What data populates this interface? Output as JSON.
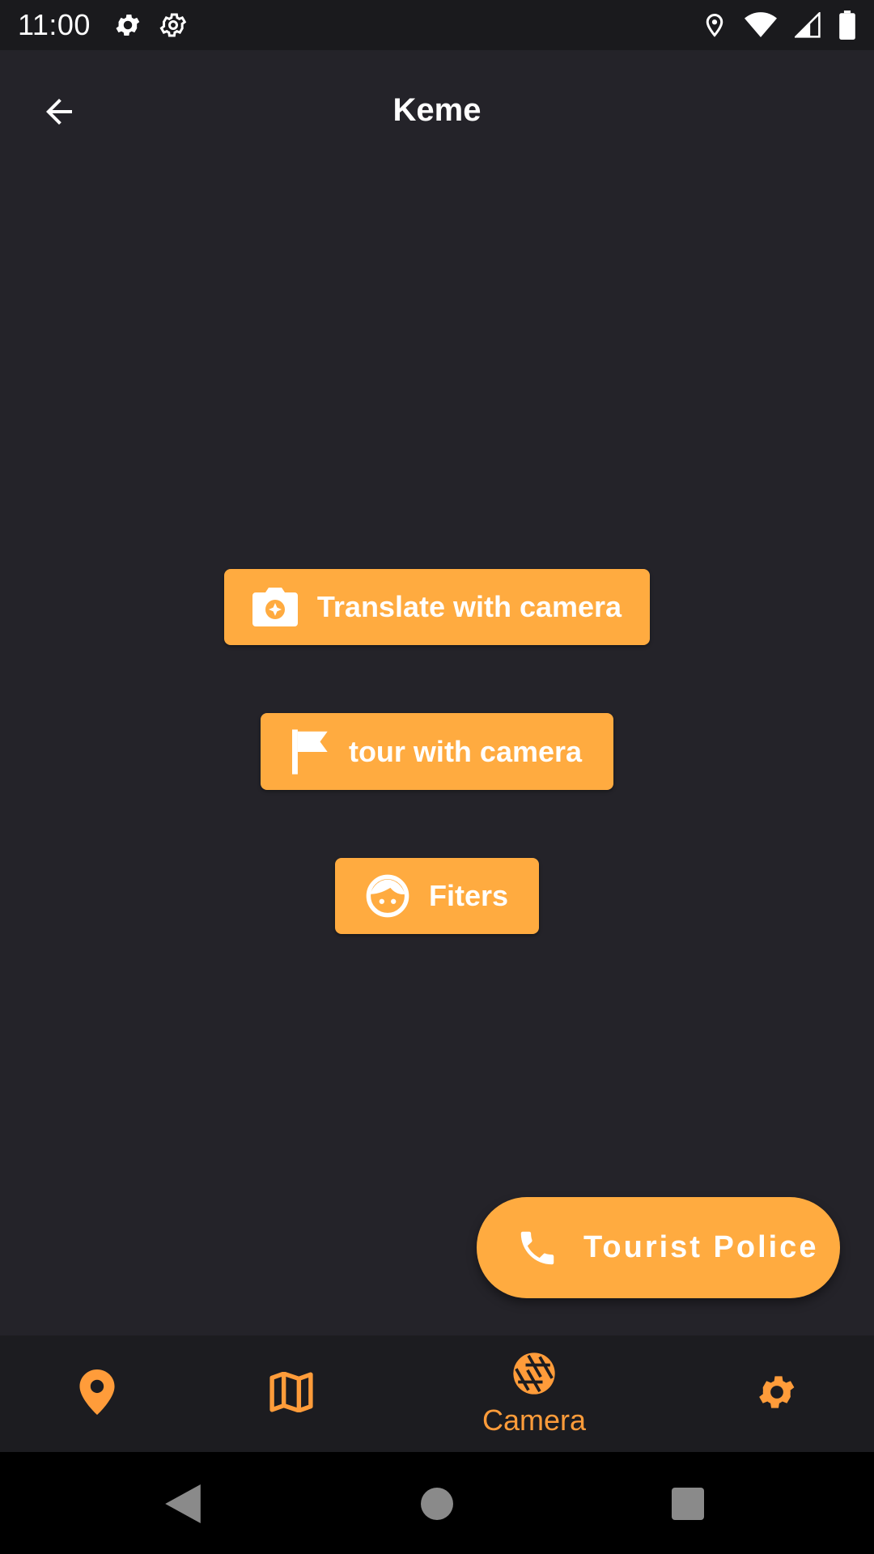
{
  "status_bar": {
    "time": "11:00",
    "left_icons": [
      "gear-icon",
      "settings-outline-icon"
    ],
    "right_icons": [
      "location-icon",
      "wifi-icon",
      "signal-icon",
      "battery-icon"
    ]
  },
  "app_bar": {
    "title": "Keme",
    "back_icon": "arrow-back-icon"
  },
  "actions": {
    "translate_label": "Translate with camera",
    "translate_icon": "camera-icon",
    "tour_label": "tour with camera",
    "tour_icon": "flag-icon",
    "filters_label": "Fiters",
    "filters_icon": "face-icon"
  },
  "fab": {
    "label": "Tourist Police",
    "icon": "phone-icon"
  },
  "bottom_nav": {
    "items": [
      {
        "icon": "location-pin-icon",
        "label": ""
      },
      {
        "icon": "map-icon",
        "label": ""
      },
      {
        "icon": "camera-aperture-icon",
        "label": "Camera",
        "selected": true
      },
      {
        "icon": "settings-icon",
        "label": ""
      }
    ]
  },
  "colors": {
    "background": "#242329",
    "accent": "#ffab40",
    "nav_accent": "#ff9c3a",
    "bottom_nav_bg": "#1c1c20"
  }
}
